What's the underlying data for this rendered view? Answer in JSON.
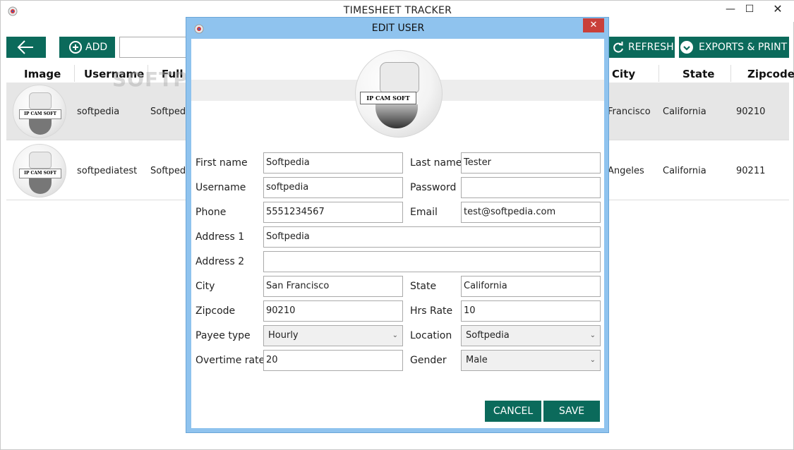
{
  "window": {
    "title": "TIMESHEET TRACKER",
    "min": "—",
    "max": "☐",
    "close": "✕"
  },
  "toolbar": {
    "add_label": "ADD",
    "refresh_label": "REFRESH",
    "export_label": "EXPORTS & PRINT",
    "search_value": ""
  },
  "table": {
    "headers": {
      "image": "Image",
      "username": "Username",
      "fullname": "Full n",
      "city": "City",
      "state": "State",
      "zipcode": "Zipcode"
    },
    "rows": [
      {
        "username": "softpedia",
        "fullname": "Softpedi",
        "city": "Francisco",
        "state": "California",
        "zipcode": "90210"
      },
      {
        "username": "softpediatest",
        "fullname": "Softpedi",
        "city": "Angeles",
        "state": "California",
        "zipcode": "90211"
      }
    ]
  },
  "watermark": "SOFTPEDIA",
  "avatar_caption": "IP CAM SOFT",
  "dialog": {
    "title": "EDIT USER",
    "close": "✕",
    "profile_caption": "IP CAM SOFT",
    "fields": {
      "first_name": {
        "label": "First name",
        "value": "Softpedia"
      },
      "last_name": {
        "label": "Last name",
        "value": "Tester"
      },
      "username": {
        "label": "Username",
        "value": "softpedia"
      },
      "password": {
        "label": "Password",
        "value": ""
      },
      "phone": {
        "label": "Phone",
        "value": "5551234567"
      },
      "email": {
        "label": "Email",
        "value": "test@softpedia.com"
      },
      "address1": {
        "label": "Address 1",
        "value": "Softpedia"
      },
      "address2": {
        "label": "Address 2",
        "value": ""
      },
      "city": {
        "label": "City",
        "value": "San Francisco"
      },
      "state": {
        "label": "State",
        "value": "California"
      },
      "zipcode": {
        "label": "Zipcode",
        "value": "90210"
      },
      "hrs_rate": {
        "label": "Hrs Rate",
        "value": "10"
      },
      "payee_type": {
        "label": "Payee type",
        "value": "Hourly"
      },
      "location": {
        "label": "Location",
        "value": "Softpedia"
      },
      "overtime_rate": {
        "label": "Overtime rate",
        "value": "20"
      },
      "gender": {
        "label": "Gender",
        "value": "Male"
      }
    },
    "cancel_label": "CANCEL",
    "save_label": "SAVE"
  },
  "colors": {
    "accent": "#0b6a5b",
    "dialog_frame": "#8fc3ee",
    "close_red": "#c9403a",
    "selected_row": "#e6e6e6"
  }
}
